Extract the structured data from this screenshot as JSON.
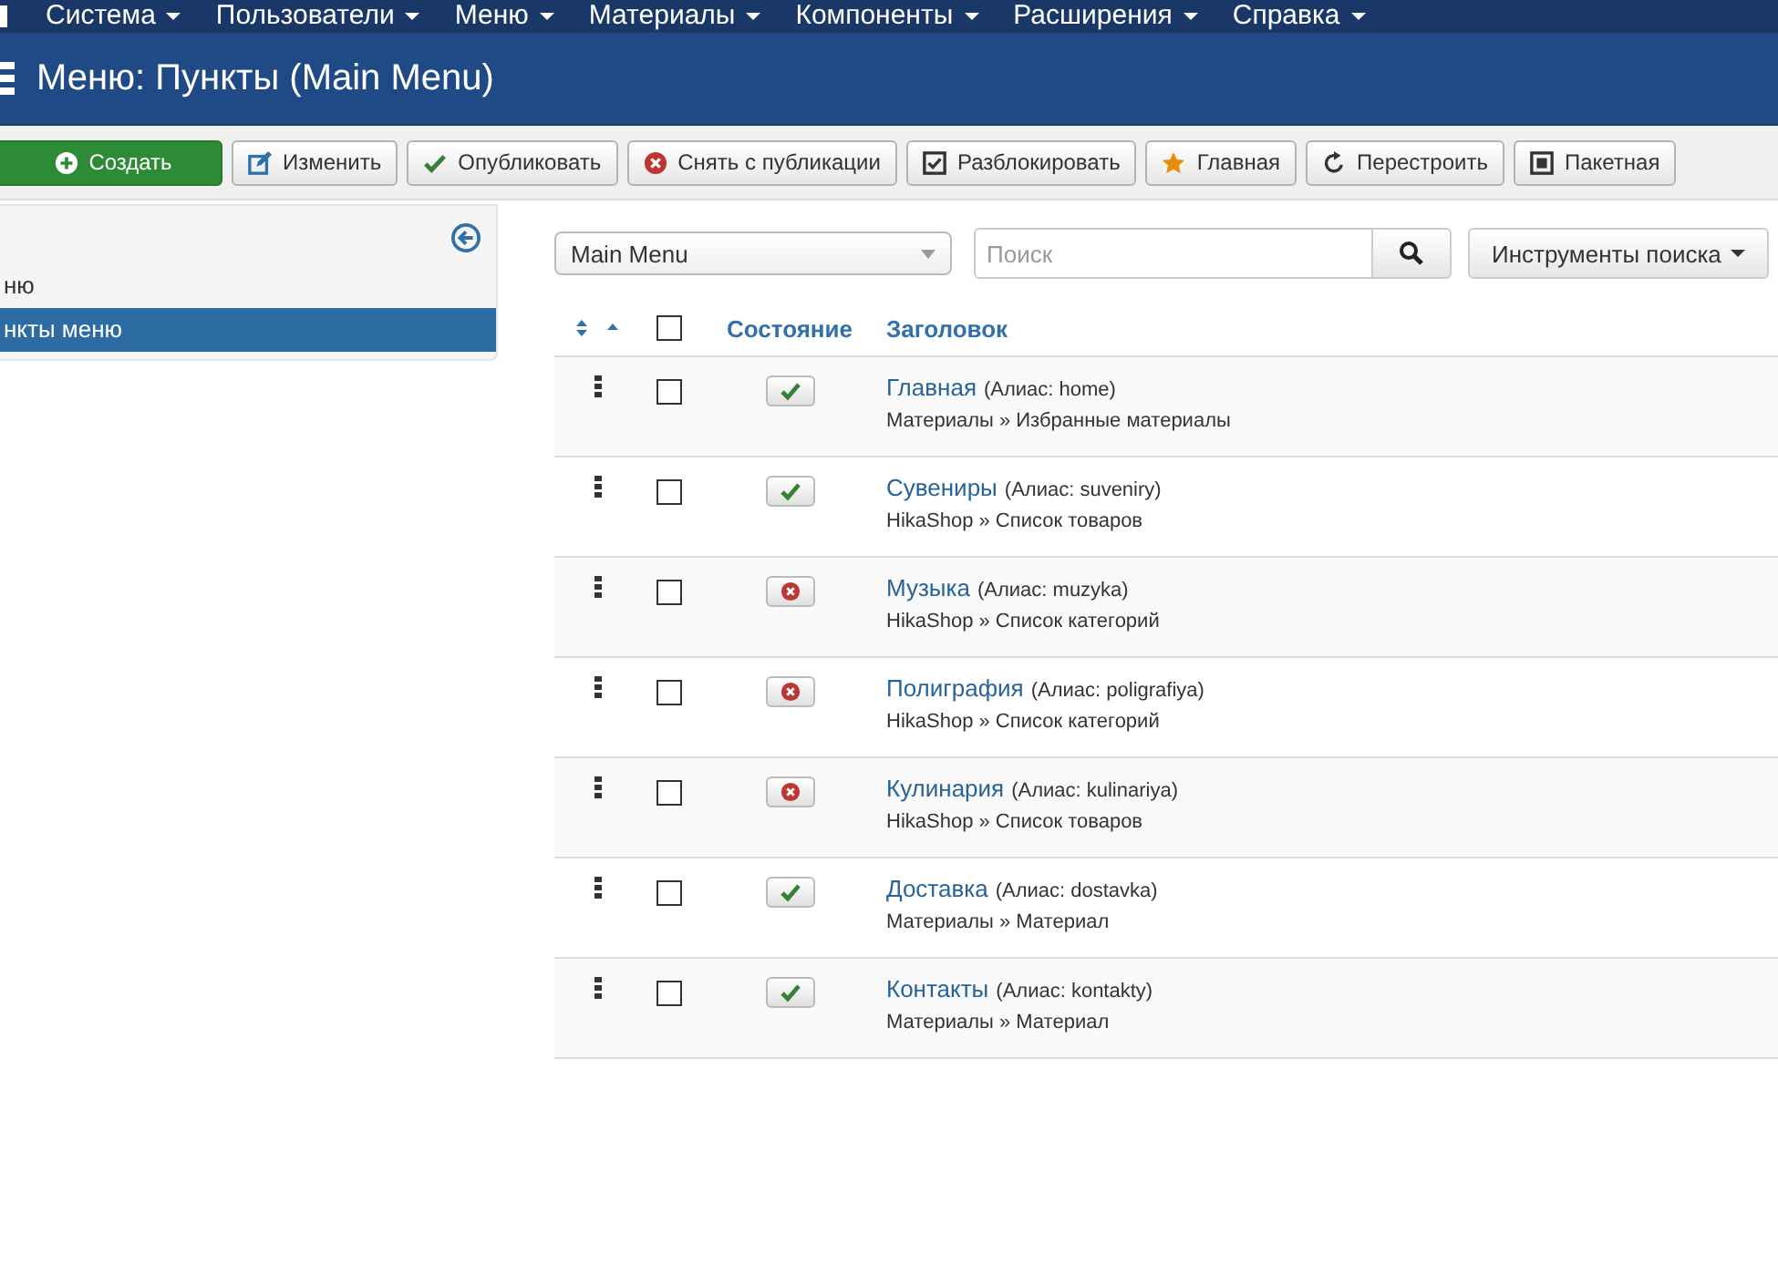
{
  "top_menu": [
    {
      "label": "Система"
    },
    {
      "label": "Пользователи"
    },
    {
      "label": "Меню"
    },
    {
      "label": "Материалы"
    },
    {
      "label": "Компоненты"
    },
    {
      "label": "Расширения"
    },
    {
      "label": "Справка"
    }
  ],
  "header": {
    "title": "Меню: Пункты (Main Menu)"
  },
  "toolbar": [
    {
      "label": "Создать",
      "kind": "new"
    },
    {
      "label": "Изменить",
      "kind": "edit"
    },
    {
      "label": "Опубликовать",
      "kind": "publish"
    },
    {
      "label": "Снять с публикации",
      "kind": "unpublish"
    },
    {
      "label": "Разблокировать",
      "kind": "checkin"
    },
    {
      "label": "Главная",
      "kind": "home"
    },
    {
      "label": "Перестроить",
      "kind": "rebuild"
    },
    {
      "label": "Пакетная",
      "kind": "batch"
    }
  ],
  "sidebar": {
    "items": [
      {
        "label": "ню",
        "selected": false
      },
      {
        "label": "нкты меню",
        "selected": true
      }
    ]
  },
  "filters": {
    "menu_select": "Main Menu",
    "search": {
      "placeholder": "Поиск"
    },
    "tools_button": "Инструменты поиска"
  },
  "table": {
    "select_all_checked": false,
    "columns": [
      "Состояние",
      "Заголовок"
    ],
    "rows": [
      {
        "title": "Главная",
        "alias": "(Алиас: home)",
        "type": "Материалы » Избранные материалы",
        "published": true,
        "checked": false
      },
      {
        "title": "Сувениры",
        "alias": "(Алиас: suveniry)",
        "type": "HikaShop » Список товаров",
        "published": true,
        "checked": false
      },
      {
        "title": "Музыка",
        "alias": "(Алиас: muzyka)",
        "type": "HikaShop » Список категорий",
        "published": false,
        "checked": false
      },
      {
        "title": "Полиграфия",
        "alias": "(Алиас: poligrafiya)",
        "type": "HikaShop » Список категорий",
        "published": false,
        "checked": false
      },
      {
        "title": "Кулинария",
        "alias": "(Алиас: kulinariya)",
        "type": "HikaShop » Список товаров",
        "published": false,
        "checked": false
      },
      {
        "title": "Доставка",
        "alias": "(Алиас: dostavka)",
        "type": "Материалы » Материал",
        "published": true,
        "checked": false
      },
      {
        "title": "Контакты",
        "alias": "(Алиас: kontakty)",
        "type": "Материалы » Материал",
        "published": true,
        "checked": false
      }
    ]
  }
}
